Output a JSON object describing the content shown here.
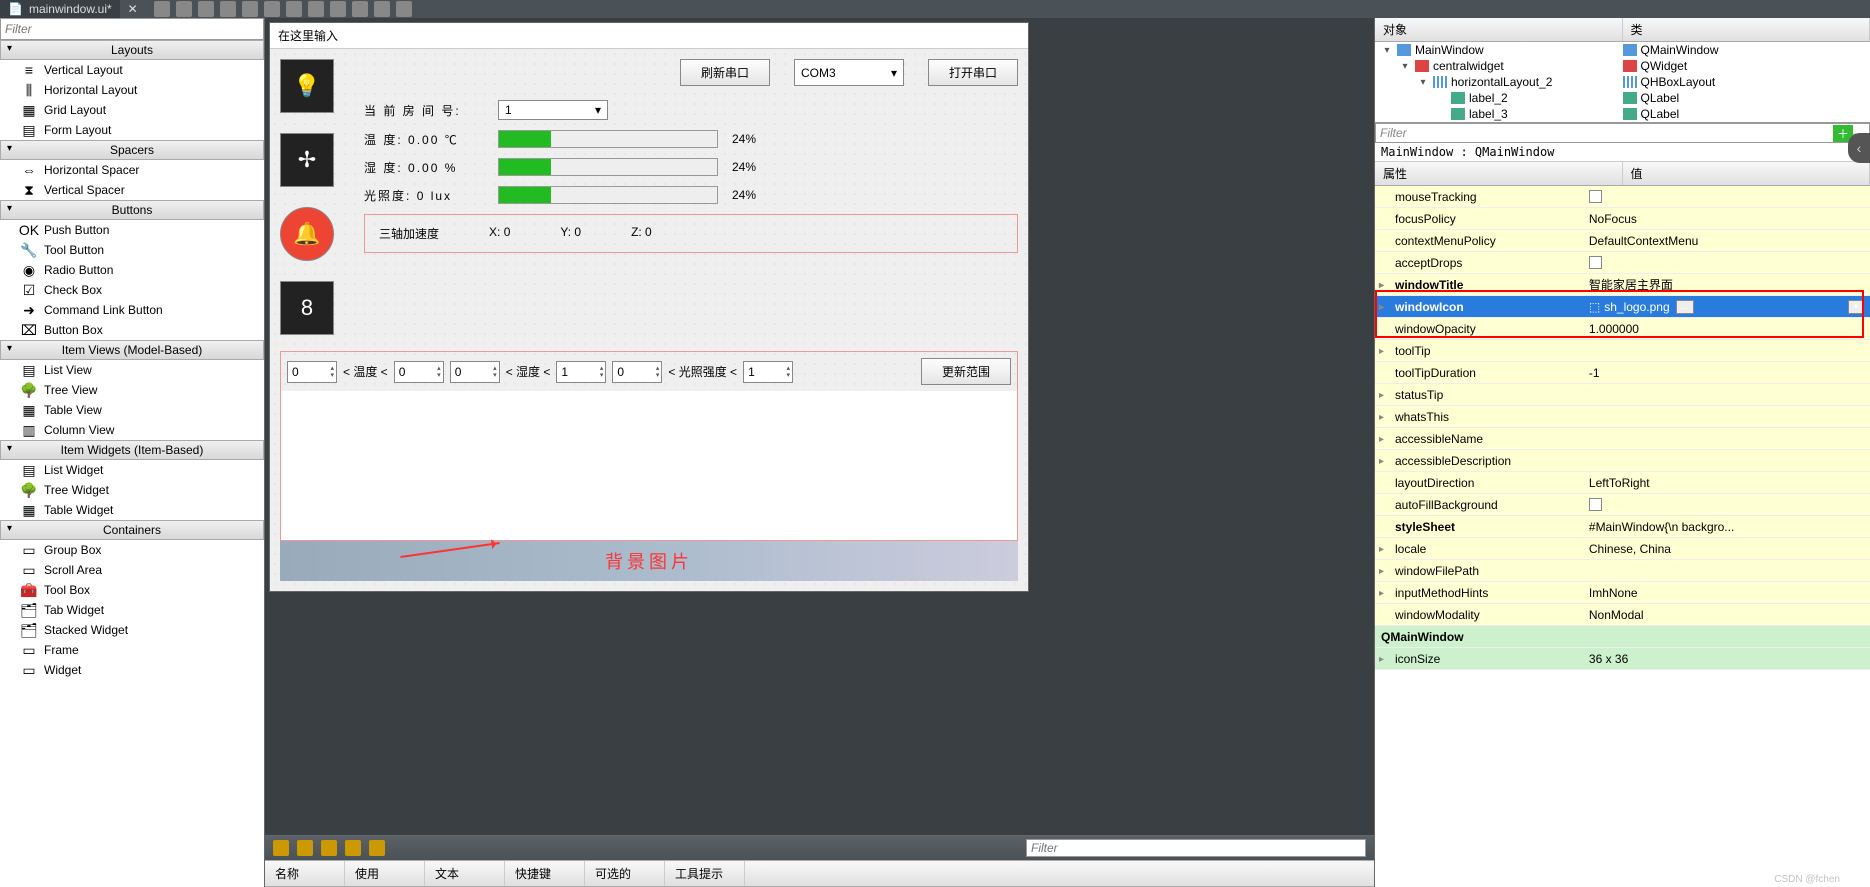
{
  "titlebar": {
    "filename": "mainwindow.ui*",
    "close": "✕"
  },
  "widgetbox": {
    "filter_placeholder": "Filter",
    "categories": [
      {
        "title": "Layouts",
        "items": [
          {
            "icon": "≡",
            "label": "Vertical Layout"
          },
          {
            "icon": "⫼",
            "label": "Horizontal Layout"
          },
          {
            "icon": "▦",
            "label": "Grid Layout"
          },
          {
            "icon": "▤",
            "label": "Form Layout"
          }
        ]
      },
      {
        "title": "Spacers",
        "items": [
          {
            "icon": "⇔",
            "label": "Horizontal Spacer"
          },
          {
            "icon": "⧗",
            "label": "Vertical Spacer"
          }
        ]
      },
      {
        "title": "Buttons",
        "items": [
          {
            "icon": "OK",
            "label": "Push Button"
          },
          {
            "icon": "🔧",
            "label": "Tool Button"
          },
          {
            "icon": "◉",
            "label": "Radio Button"
          },
          {
            "icon": "☑",
            "label": "Check Box"
          },
          {
            "icon": "➜",
            "label": "Command Link Button"
          },
          {
            "icon": "⌧",
            "label": "Button Box"
          }
        ]
      },
      {
        "title": "Item Views (Model-Based)",
        "items": [
          {
            "icon": "▤",
            "label": "List View"
          },
          {
            "icon": "🌳",
            "label": "Tree View"
          },
          {
            "icon": "▦",
            "label": "Table View"
          },
          {
            "icon": "▥",
            "label": "Column View"
          }
        ]
      },
      {
        "title": "Item Widgets (Item-Based)",
        "items": [
          {
            "icon": "▤",
            "label": "List Widget"
          },
          {
            "icon": "🌳",
            "label": "Tree Widget"
          },
          {
            "icon": "▦",
            "label": "Table Widget"
          }
        ]
      },
      {
        "title": "Containers",
        "items": [
          {
            "icon": "▭",
            "label": "Group Box"
          },
          {
            "icon": "▭",
            "label": "Scroll Area"
          },
          {
            "icon": "🧰",
            "label": "Tool Box"
          },
          {
            "icon": "🗂",
            "label": "Tab Widget"
          },
          {
            "icon": "🗂",
            "label": "Stacked Widget"
          },
          {
            "icon": "▭",
            "label": "Frame"
          },
          {
            "icon": "▭",
            "label": "Widget"
          }
        ]
      }
    ]
  },
  "form": {
    "header_hint": "在这里输入",
    "refresh_btn": "刷新串口",
    "com_value": "COM3",
    "open_btn": "打开串口",
    "room_label": "当 前 房 间 号:",
    "room_value": "1",
    "temp_label": "温  度:",
    "temp_value": "0.00 ℃",
    "temp_pct": "24%",
    "humi_label": "湿  度:",
    "humi_value": "0.00 %",
    "humi_pct": "24%",
    "lux_label": "光照度:",
    "lux_value": "0 lux",
    "lux_pct": "24%",
    "accel_label": "三轴加速度",
    "ax": "X: 0",
    "ay": "Y: 0",
    "az": "Z: 0",
    "range": {
      "v": [
        "0",
        "0",
        "0",
        "1",
        "0",
        "1"
      ],
      "lt_temp": "< 温度 <",
      "lt_humi": "< 湿度 <",
      "lt_lux": "< 光照强度 <",
      "update_btn": "更新范围"
    },
    "bg_label": "背景图片"
  },
  "bottom": {
    "filter_placeholder": "Filter",
    "cols": [
      "名称",
      "使用",
      "文本",
      "快捷键",
      "可选的",
      "工具提示"
    ]
  },
  "objtree": {
    "head": [
      "对象",
      "类"
    ],
    "rows": [
      {
        "indent": 0,
        "exp": "▾",
        "name": "MainWindow",
        "cls": "QMainWindow",
        "ic": "objicon"
      },
      {
        "indent": 1,
        "exp": "▾",
        "name": "centralwidget",
        "cls": "QWidget",
        "ic": "objicon red"
      },
      {
        "indent": 2,
        "exp": "▾",
        "name": "horizontalLayout_2",
        "cls": "QHBoxLayout",
        "ic": "objicon layout"
      },
      {
        "indent": 3,
        "exp": "",
        "name": "label_2",
        "cls": "QLabel",
        "ic": "objicon widget"
      },
      {
        "indent": 3,
        "exp": "",
        "name": "label_3",
        "cls": "QLabel",
        "ic": "objicon widget"
      }
    ],
    "filter_placeholder": "Filter",
    "objpath": "MainWindow : QMainWindow"
  },
  "props": {
    "head": [
      "属性",
      "值"
    ],
    "rows": [
      {
        "k": "mouseTracking",
        "v": "",
        "chk": true,
        "cls": "yellow"
      },
      {
        "k": "focusPolicy",
        "v": "NoFocus",
        "cls": "yellow"
      },
      {
        "k": "contextMenuPolicy",
        "v": "DefaultContextMenu",
        "cls": "yellow"
      },
      {
        "k": "acceptDrops",
        "v": "",
        "chk": true,
        "cls": "yellow"
      },
      {
        "k": "windowTitle",
        "v": "智能家居主界面",
        "cls": "yellow bold",
        "exp": true
      },
      {
        "k": "windowIcon",
        "v": "sh_logo.png",
        "cls": "sel bold",
        "exp": true,
        "dd": true
      },
      {
        "k": "windowOpacity",
        "v": "1.000000",
        "cls": "yellow"
      },
      {
        "k": "toolTip",
        "v": "",
        "cls": "yellow",
        "exp": true
      },
      {
        "k": "toolTipDuration",
        "v": "-1",
        "cls": "yellow"
      },
      {
        "k": "statusTip",
        "v": "",
        "cls": "yellow",
        "exp": true
      },
      {
        "k": "whatsThis",
        "v": "",
        "cls": "yellow",
        "exp": true
      },
      {
        "k": "accessibleName",
        "v": "",
        "cls": "yellow",
        "exp": true
      },
      {
        "k": "accessibleDescription",
        "v": "",
        "cls": "yellow",
        "exp": true
      },
      {
        "k": "layoutDirection",
        "v": "LeftToRight",
        "cls": "yellow"
      },
      {
        "k": "autoFillBackground",
        "v": "",
        "chk": true,
        "cls": "yellow"
      },
      {
        "k": "styleSheet",
        "v": "#MainWindow{\\n  backgro...",
        "cls": "yellow bold"
      },
      {
        "k": "locale",
        "v": "Chinese, China",
        "cls": "yellow",
        "exp": true
      },
      {
        "k": "windowFilePath",
        "v": "",
        "cls": "yellow",
        "exp": true
      },
      {
        "k": "inputMethodHints",
        "v": "ImhNone",
        "cls": "yellow",
        "exp": true
      },
      {
        "k": "windowModality",
        "v": "NonModal",
        "cls": "yellow"
      },
      {
        "k": "QMainWindow",
        "v": "",
        "cls": "blue bold",
        "group": true
      },
      {
        "k": "iconSize",
        "v": "36 x 36",
        "cls": "blue",
        "exp": true
      }
    ]
  },
  "watermark": "CSDN @fchen"
}
